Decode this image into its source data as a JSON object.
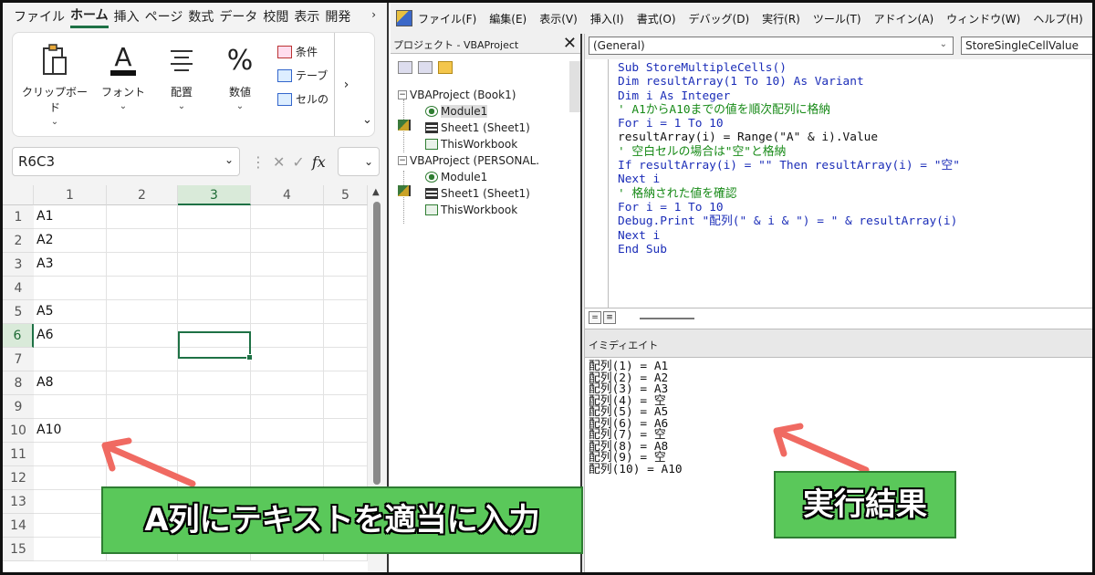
{
  "excel": {
    "tabs": [
      "ファイル",
      "ホーム",
      "挿入",
      "ページ",
      "数式",
      "データ",
      "校閲",
      "表示",
      "開発"
    ],
    "active_tab": "ホーム",
    "tab_more": "›",
    "ribbon": {
      "clipboard": "クリップボード",
      "font": "フォント",
      "alignment": "配置",
      "number": "数値",
      "side_items": [
        "条件",
        "テーブ",
        "セルの"
      ],
      "overflow": "›",
      "collapse": "⌄"
    },
    "name_box": "R6C3",
    "fx_label": "fx",
    "columns": [
      "1",
      "2",
      "3",
      "4",
      "5"
    ],
    "selected_column": "3",
    "rows": [
      "1",
      "2",
      "3",
      "4",
      "5",
      "6",
      "7",
      "8",
      "9",
      "10",
      "11",
      "12",
      "13",
      "14",
      "15"
    ],
    "selected_row": "6",
    "column_a_values": [
      "A1",
      "A2",
      "A3",
      "",
      "A5",
      "A6",
      "",
      "A8",
      "",
      "A10",
      "",
      "",
      "",
      "",
      ""
    ]
  },
  "vbe": {
    "menu": [
      "ファイル(F)",
      "編集(E)",
      "表示(V)",
      "挿入(I)",
      "書式(O)",
      "デバッグ(D)",
      "実行(R)",
      "ツール(T)",
      "アドイン(A)",
      "ウィンドウ(W)",
      "ヘルプ(H)"
    ],
    "project_title": "プロジェクト - VBAProject",
    "project_close": "✕",
    "tree": {
      "project1": "VBAProject (Book1)",
      "module1": "Module1",
      "sheet1": "Sheet1 (Sheet1)",
      "thisworkbook1": "ThisWorkbook",
      "project2": "VBAProject (PERSONAL.",
      "module2": "Module1",
      "sheet2": "Sheet1 (Sheet1)",
      "thisworkbook2": "ThisWorkbook"
    },
    "object_combo": "(General)",
    "proc_combo": "StoreSingleCellValue",
    "code_lines": [
      [
        {
          "t": "Sub StoreMultipleCells()",
          "c": "blue"
        }
      ],
      [
        {
          "t": "Dim resultArray(1 To 10) As Variant",
          "c": "blue"
        }
      ],
      [
        {
          "t": "Dim i As Integer",
          "c": "blue"
        }
      ],
      [
        {
          "t": "' A1からA10までの値を順次配列に格納",
          "c": "green"
        }
      ],
      [
        {
          "t": "For i = 1 To 10",
          "c": "blue"
        }
      ],
      [
        {
          "t": "resultArray(i) = Range(\"A\" & i).Value",
          "c": "black"
        }
      ],
      [
        {
          "t": "' 空白セルの場合は\"空\"と格納",
          "c": "green"
        }
      ],
      [
        {
          "t": "If resultArray(i) = \"\" Then resultArray(i) = \"空\"",
          "c": "blue"
        }
      ],
      [
        {
          "t": "Next i",
          "c": "blue"
        }
      ],
      [
        {
          "t": "' 格納された値を確認",
          "c": "green"
        }
      ],
      [
        {
          "t": "For i = 1 To 10",
          "c": "blue"
        }
      ],
      [
        {
          "t": "Debug.Print \"配列(\" & i & \") = \" & resultArray(i)",
          "c": "blue"
        }
      ],
      [
        {
          "t": "Next i",
          "c": "blue"
        }
      ],
      [
        {
          "t": "End Sub",
          "c": "blue"
        }
      ]
    ],
    "immediate_title": "イミディエイト",
    "immediate_lines": [
      "配列(1) = A1",
      "配列(2) = A2",
      "配列(3) = A3",
      "配列(4) = 空",
      "配列(5) = A5",
      "配列(6) = A6",
      "配列(7) = 空",
      "配列(8) = A8",
      "配列(9) = 空",
      "配列(10) = A10"
    ]
  },
  "callouts": {
    "left": "A列にテキストを適当に入力",
    "right": "実行結果"
  },
  "colors": {
    "callout_fill": "#5ac85a",
    "arrow": "#f06a62",
    "excel_green": "#1e7145",
    "vba_keyword": "#1b2db8",
    "vba_comment": "#178a17"
  }
}
